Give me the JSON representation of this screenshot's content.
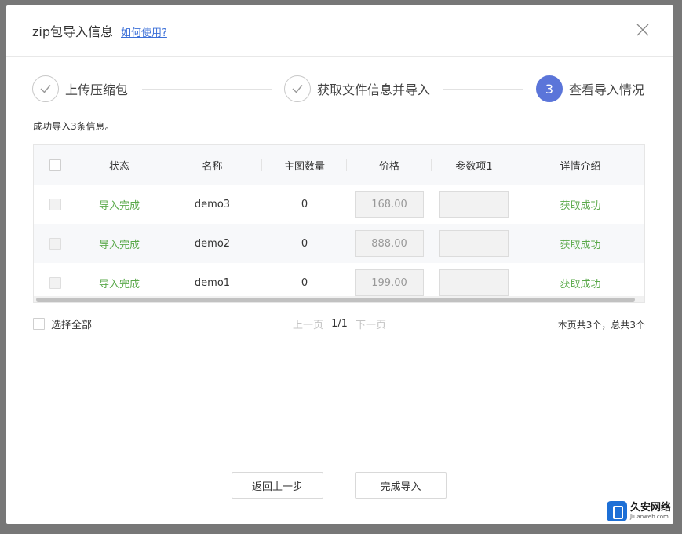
{
  "dialog": {
    "title": "zip包导入信息",
    "help_link": "如何使用?"
  },
  "steps": [
    {
      "label": "上传压缩包",
      "state": "done"
    },
    {
      "label": "获取文件信息并导入",
      "state": "done"
    },
    {
      "number": "3",
      "label": "查看导入情况",
      "state": "active"
    }
  ],
  "result_message": "成功导入3条信息。",
  "table": {
    "headers": [
      "状态",
      "名称",
      "主图数量",
      "价格",
      "参数项1",
      "详情介绍"
    ],
    "rows": [
      {
        "status": "导入完成",
        "name": "demo3",
        "image_count": "0",
        "price": "168.00",
        "param1": "",
        "detail": "获取成功"
      },
      {
        "status": "导入完成",
        "name": "demo2",
        "image_count": "0",
        "price": "888.00",
        "param1": "",
        "detail": "获取成功"
      },
      {
        "status": "导入完成",
        "name": "demo1",
        "image_count": "0",
        "price": "199.00",
        "param1": "",
        "detail": "获取成功"
      }
    ]
  },
  "footer": {
    "select_all": "选择全部",
    "prev_page": "上一页",
    "page": "1/1",
    "next_page": "下一页",
    "page_info": "本页共3个，总共3个"
  },
  "buttons": {
    "back": "返回上一步",
    "finish": "完成导入"
  },
  "watermark": {
    "main": "久安网络",
    "sub": "Jiuanweb.com"
  },
  "colors": {
    "accent": "#5b75d9",
    "success": "#5aa94a",
    "link": "#3b6fd8"
  }
}
